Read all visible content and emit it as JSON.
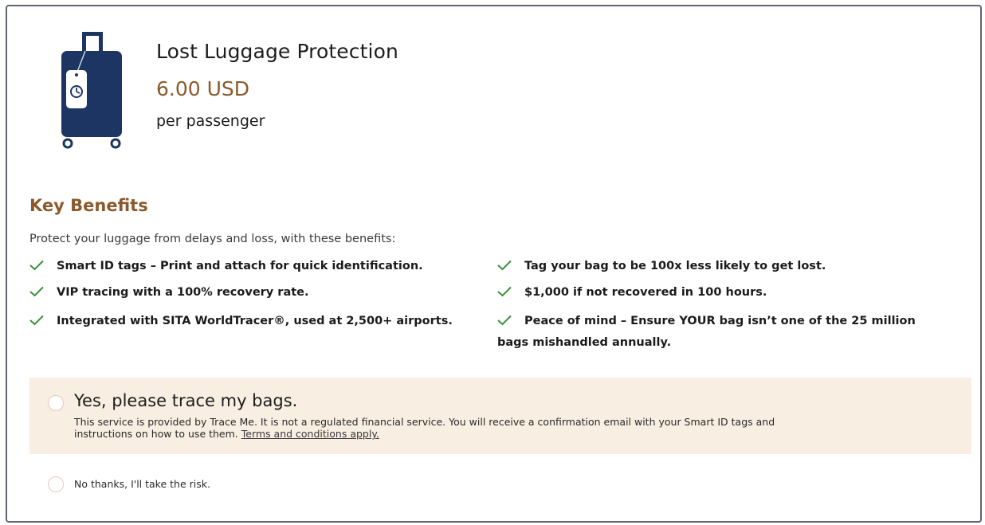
{
  "product": {
    "title": "Lost Luggage Protection",
    "price": "6.00 USD",
    "unit": "per passenger",
    "icon": "luggage-icon"
  },
  "benefits": {
    "heading": "Key Benefits",
    "intro": "Protect your luggage from delays and loss, with these benefits:",
    "left": [
      "Smart ID tags – Print and attach for quick identification.",
      "VIP tracing with a 100% recovery rate.",
      "Integrated with SITA WorldTracer®, used at 2,500+ airports."
    ],
    "right": [
      "Tag your bag to be 100x less likely to get lost.",
      "$1,000 if not recovered in 100 hours.",
      "Peace of mind – Ensure YOUR bag isn’t one of the 25 million"
    ],
    "right_last_line2": "bags mishandled annually."
  },
  "options": {
    "yes": {
      "label": "Yes, please trace my bags.",
      "description_line1": "This service is provided by Trace Me. It is not a regulated financial service. You will receive a confirmation email with your Smart ID tags and",
      "description_line2": "instructions on how to use them.",
      "terms_link": "Terms and conditions apply."
    },
    "no": {
      "label": "No thanks, I'll take the risk."
    }
  },
  "colors": {
    "accent_brown": "#8a5a2c",
    "check_green": "#3c8f3c",
    "luggage_navy": "#1c3563",
    "highlight_bg": "#f8eee1"
  }
}
